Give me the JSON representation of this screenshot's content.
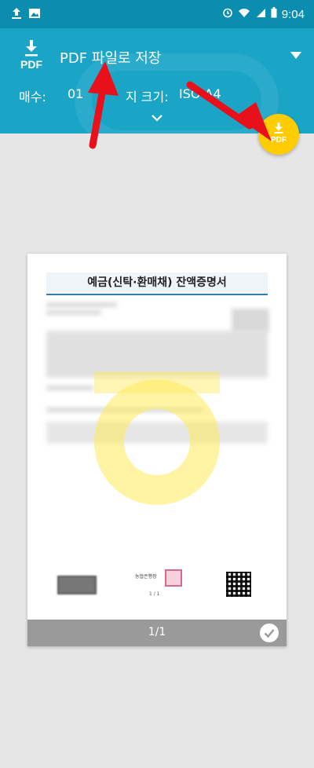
{
  "status_bar": {
    "time": "9:04",
    "left_icons": [
      "upload-icon",
      "image-icon"
    ],
    "right_icons": [
      "alarm-icon",
      "wifi-icon",
      "signal-icon",
      "battery-icon"
    ]
  },
  "header": {
    "icon_label": "PDF",
    "title": "PDF 파일로 저장",
    "copies_label": "매수:",
    "copies_value": "01",
    "paper_size_label": "지 크기:",
    "paper_size_value": "ISO A4"
  },
  "fab": {
    "label": "PDF"
  },
  "document": {
    "title": "예금(신탁·환매채) 잔액증명서",
    "seal_text": "농협은행장",
    "seal_sub": "1  /  1"
  },
  "footer": {
    "page_count": "1/1"
  },
  "colors": {
    "header": "#1aa5c7",
    "statusbar": "#0b8db0",
    "fab": "#ffcc00",
    "arrow": "#e8101a"
  }
}
